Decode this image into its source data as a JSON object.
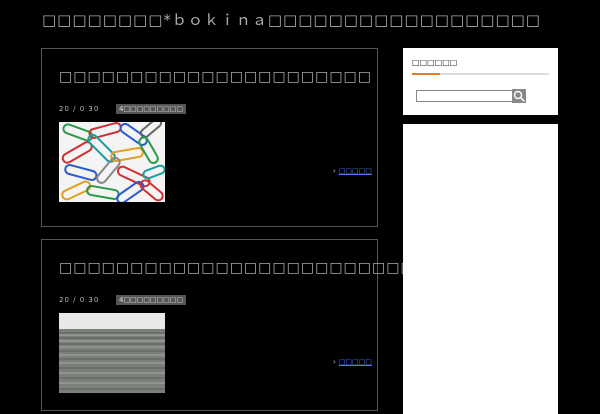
{
  "site": {
    "title": "□□□□□□□□*ｂｏｋｉｎａ□□□□□□□□□□□□□□□□□□"
  },
  "posts": [
    {
      "title": "□□□□□□□□□□□□□□□□□□□□□□",
      "date": "20 / 0 30",
      "category": "4□□□□□□□□□",
      "read_more": "□□□□□",
      "thumb_alt": "colorful paper clips"
    },
    {
      "title": "□□□□□□□□□□□□□□□□□□□□□□□□□□□□□□□□□□□",
      "date": "20 / 0 30",
      "category": "4□□□□□□□□□",
      "read_more": "□□□□□",
      "thumb_alt": "grey concrete steps"
    }
  ],
  "sidebar": {
    "widget_title": "□□□□□□",
    "search": {
      "placeholder": "",
      "value": ""
    },
    "accent_color": "#e07a2a"
  },
  "icons": {
    "search": "search-icon",
    "chevron": "chevron-right-icon"
  }
}
